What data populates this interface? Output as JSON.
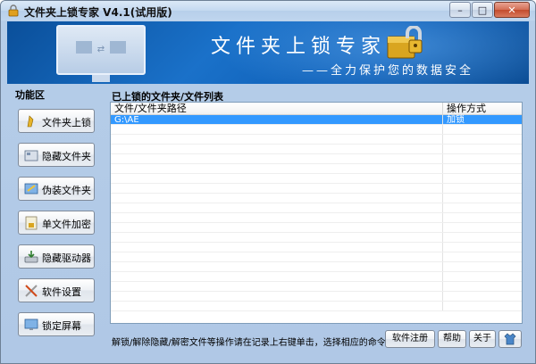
{
  "window": {
    "title": "文件夹上锁专家 V4.1(试用版)",
    "controls": {
      "minimize": "–",
      "maximize": "□",
      "close": "✕"
    }
  },
  "banner": {
    "title": "文件夹上锁专家",
    "subtitle": "——全力保护您的数据安全"
  },
  "sidebar": {
    "title": "功能区",
    "items": [
      {
        "label": "文件夹上锁",
        "icon": "folder-lock-icon"
      },
      {
        "label": "隐藏文件夹",
        "icon": "hide-folder-icon"
      },
      {
        "label": "伪装文件夹",
        "icon": "disguise-folder-icon"
      },
      {
        "label": "单文件加密",
        "icon": "file-encrypt-icon"
      },
      {
        "label": "隐藏驱动器",
        "icon": "hide-drive-icon"
      },
      {
        "label": "软件设置",
        "icon": "settings-tools-icon"
      },
      {
        "label": "锁定屏幕",
        "icon": "lock-screen-icon"
      }
    ]
  },
  "list": {
    "title": "已上锁的文件夹/文件列表",
    "columns": {
      "path": "文件/文件夹路径",
      "op": "操作方式"
    },
    "rows": [
      {
        "path": "G:\\AE",
        "op": "加锁"
      }
    ]
  },
  "footer": {
    "hint": "解锁/解除隐藏/解密文件等操作请在记录上右键单击，选择相应的命令。",
    "register": "软件注册",
    "help": "帮助",
    "about": "关于",
    "skin_icon": "shirt-icon"
  },
  "colors": {
    "selection": "#3399ff",
    "banner": "#1a71c9"
  }
}
